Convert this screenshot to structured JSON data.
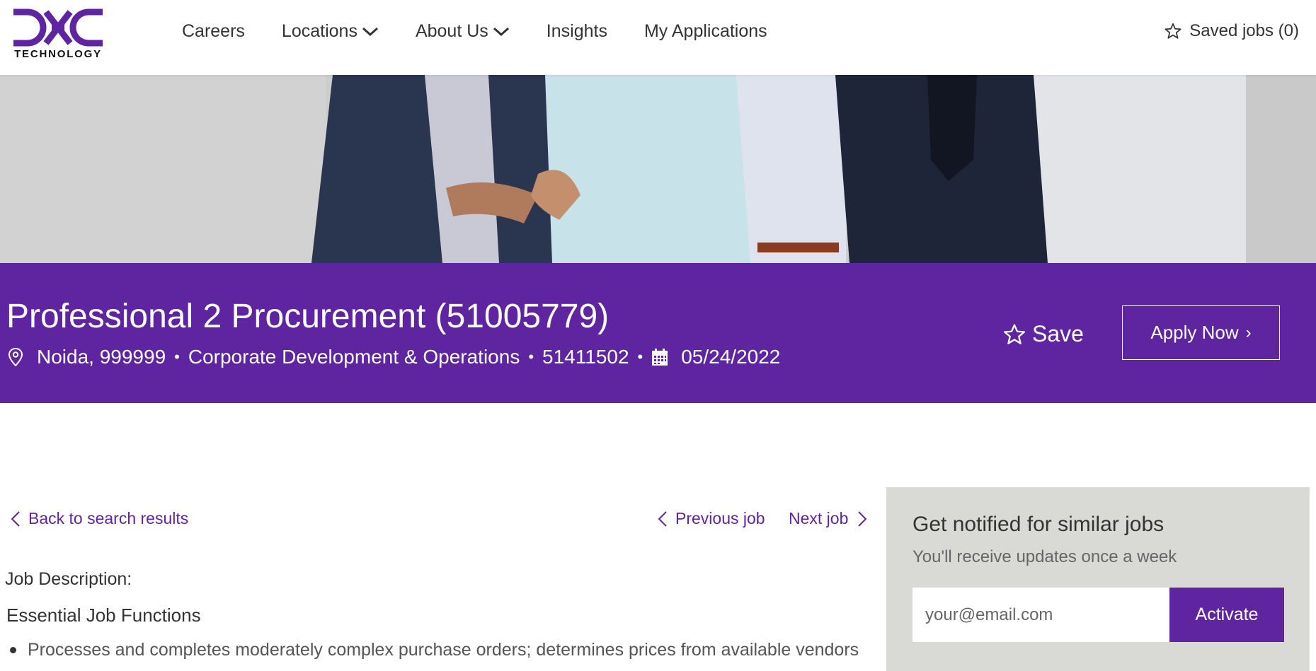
{
  "brand": {
    "logo_text": "TECHNOLOGY",
    "logo_mark_text": "DXC",
    "purple": "#5f249f"
  },
  "nav": {
    "items": [
      {
        "label": "Careers",
        "has_dropdown": false
      },
      {
        "label": "Locations",
        "has_dropdown": true
      },
      {
        "label": "About Us",
        "has_dropdown": true
      },
      {
        "label": "Insights",
        "has_dropdown": false
      },
      {
        "label": "My Applications",
        "has_dropdown": false
      }
    ],
    "saved_jobs_label": "Saved jobs (0)",
    "saved_jobs_icon": "star-outline-icon"
  },
  "job": {
    "title": "Professional 2 Procurement (51005779)",
    "location": "Noida, 999999",
    "department": "Corporate Development & Operations",
    "job_id": "51411502",
    "date": "05/24/2022",
    "save_label": "Save",
    "apply_label": "Apply Now"
  },
  "navigation": {
    "back_label": "Back to search results",
    "previous_label": "Previous job",
    "next_label": "Next job"
  },
  "description": {
    "label": "Job Description:",
    "heading": "Essential Job Functions",
    "bullets": [
      "Processes and completes moderately complex purchase orders; determines prices from available vendors"
    ]
  },
  "notify": {
    "title": "Get notified for similar jobs",
    "subtitle": "You'll receive updates once a week",
    "email_placeholder": "your@email.com",
    "activate_label": "Activate"
  }
}
